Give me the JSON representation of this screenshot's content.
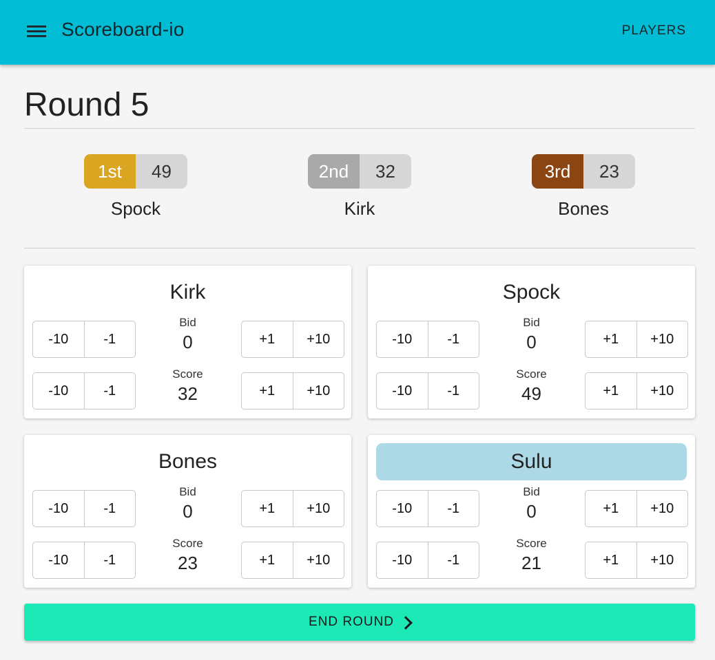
{
  "app": {
    "title": "Scoreboard-io",
    "menu_icon": "menu-icon",
    "players_label": "PLAYERS"
  },
  "round": {
    "title": "Round 5"
  },
  "colors": {
    "toolbar": "#00bcd4",
    "gold": "#daa520",
    "silver": "#a9a9a9",
    "bronze": "#8b4513",
    "active_player": "#add8e6",
    "end_round": "#1de9b6"
  },
  "podium": [
    {
      "rank": "1st",
      "score": "49",
      "name": "Spock",
      "color": "#daa520"
    },
    {
      "rank": "2nd",
      "score": "32",
      "name": "Kirk",
      "color": "#a9a9a9"
    },
    {
      "rank": "3rd",
      "score": "23",
      "name": "Bones",
      "color": "#8b4513"
    }
  ],
  "players": [
    {
      "name": "Kirk",
      "bid_label": "Bid",
      "bid": "0",
      "score_label": "Score",
      "score": "32",
      "active": false
    },
    {
      "name": "Spock",
      "bid_label": "Bid",
      "bid": "0",
      "score_label": "Score",
      "score": "49",
      "active": false
    },
    {
      "name": "Bones",
      "bid_label": "Bid",
      "bid": "0",
      "score_label": "Score",
      "score": "23",
      "active": false
    },
    {
      "name": "Sulu",
      "bid_label": "Bid",
      "bid": "0",
      "score_label": "Score",
      "score": "21",
      "active": true
    }
  ],
  "buttons": {
    "minus_ten": "-10",
    "minus_one": "-1",
    "plus_one": "+1",
    "plus_ten": "+10"
  },
  "end_round": {
    "label": "END ROUND",
    "icon": "chevron-right-icon"
  }
}
